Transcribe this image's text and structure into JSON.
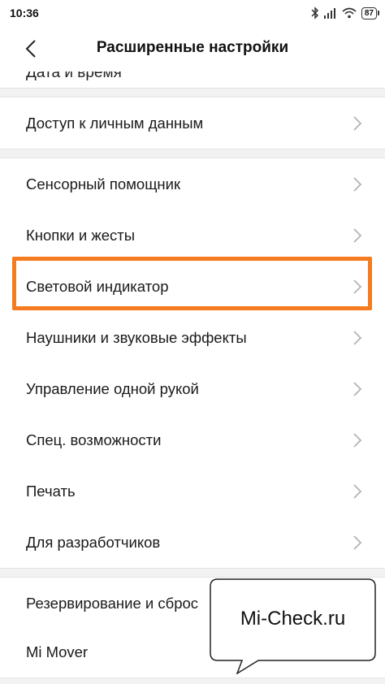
{
  "status_bar": {
    "time": "10:36",
    "battery": "87",
    "icons": [
      "bluetooth-icon",
      "signal-icon",
      "wifi-icon",
      "battery-icon"
    ]
  },
  "header": {
    "title": "Расширенные настройки",
    "back_icon": "chevron-left-icon",
    "cut_off_text": "Дата и время"
  },
  "sections": [
    {
      "items": [
        {
          "label": "Доступ к личным данным"
        }
      ]
    },
    {
      "items": [
        {
          "label": "Сенсорный помощник"
        },
        {
          "label": "Кнопки и жесты"
        },
        {
          "label": "Световой индикатор",
          "highlighted": true
        },
        {
          "label": "Наушники и звуковые эффекты"
        },
        {
          "label": "Управление одной рукой"
        },
        {
          "label": "Спец. возможности"
        },
        {
          "label": "Печать"
        },
        {
          "label": "Для разработчиков"
        }
      ]
    },
    {
      "items": [
        {
          "label": "Резервирование и сброс"
        },
        {
          "label": "Mi Mover"
        }
      ]
    }
  ],
  "chevron_icon": "chevron-right-icon",
  "highlight_color": "#f47b20",
  "watermark": {
    "text": "Mi-Check.ru"
  }
}
